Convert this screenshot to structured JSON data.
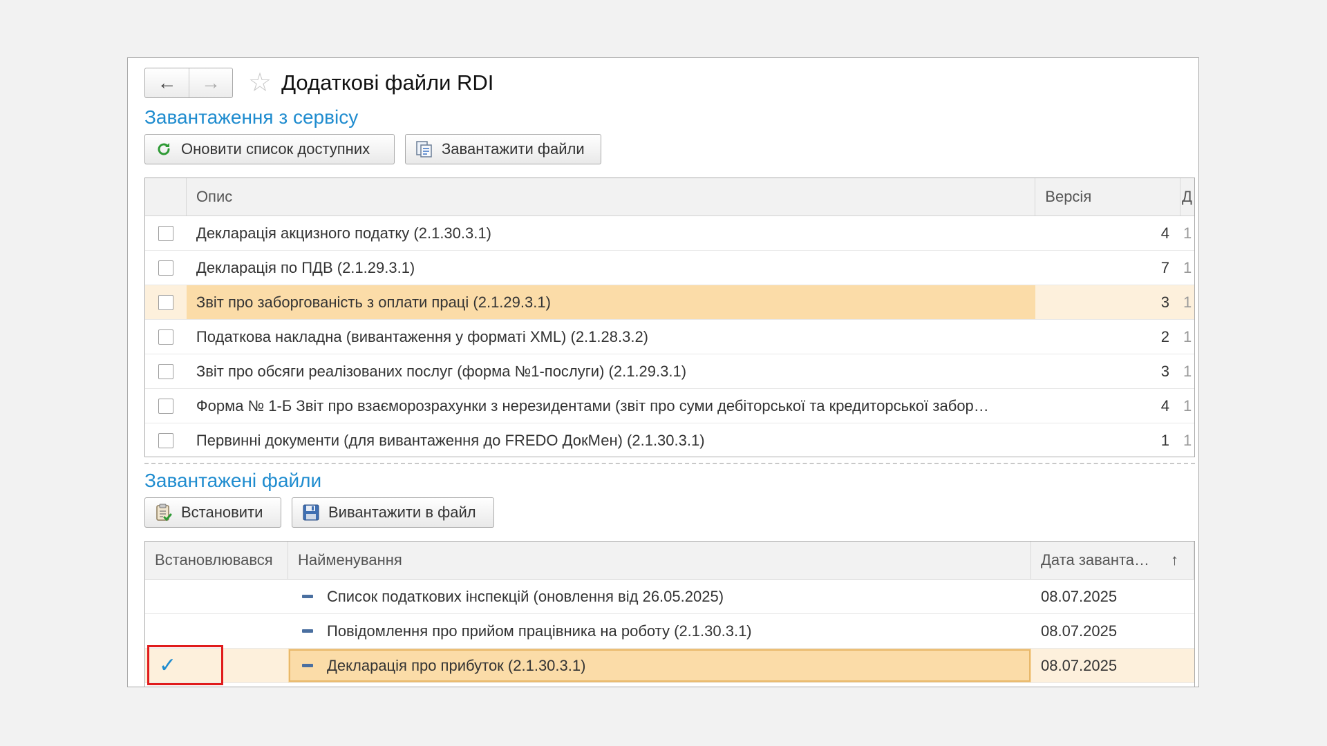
{
  "window": {
    "title": "Додаткові файли RDI",
    "nav_back": "←",
    "nav_forward": "→",
    "favorite": "☆"
  },
  "section_service": {
    "title": "Завантаження з сервісу",
    "refresh_label": "Оновити список доступних",
    "download_label": "Завантажити файли",
    "columns": [
      "",
      "Опис",
      "Версія",
      "Д"
    ],
    "rows": [
      {
        "checked": false,
        "description": "Декларація акцизного податку (2.1.30.3.1)",
        "version": "4",
        "extra": "1"
      },
      {
        "checked": false,
        "description": "Декларація по ПДВ (2.1.29.3.1)",
        "version": "7",
        "extra": "1"
      },
      {
        "checked": false,
        "description": "Звіт про заборгованість з оплати праці (2.1.29.3.1)",
        "version": "3",
        "extra": "1",
        "selected": true
      },
      {
        "checked": false,
        "description": "Податкова накладна (вивантаження у форматі XML) (2.1.28.3.2)",
        "version": "2",
        "extra": "1"
      },
      {
        "checked": false,
        "description": "Звіт про обсяги реалізованих послуг (форма №1-послуги) (2.1.29.3.1)",
        "version": "3",
        "extra": "1"
      },
      {
        "checked": false,
        "description": "Форма № 1-Б Звіт про взаєморозрахунки з нерезидентами (звіт про суми дебіторської та кредиторської забор…",
        "version": "4",
        "extra": "1"
      },
      {
        "checked": false,
        "description": "Первинні документи (для вивантаження до FREDO ДокМен) (2.1.30.3.1)",
        "version": "1",
        "extra": "1"
      }
    ]
  },
  "section_loaded": {
    "title": "Завантажені файли",
    "install_label": "Встановити",
    "export_label": "Вивантажити в файл",
    "columns": [
      "Встановлювався",
      "Найменування",
      "Дата заванта…"
    ],
    "sort_indicator": "↑",
    "rows": [
      {
        "installed": "",
        "name": "Список податкових інспекцій (оновлення від 26.05.2025)",
        "date": "08.07.2025"
      },
      {
        "installed": "",
        "name": "Повідомлення про прийом працівника на роботу (2.1.30.3.1)",
        "date": "08.07.2025"
      },
      {
        "installed": "✓",
        "name": "Декларація про прибуток (2.1.30.3.1)",
        "date": "08.07.2025",
        "selected": true
      }
    ]
  },
  "colors": {
    "section_title": "#1f8ccf",
    "selected_row": "#fdf0dc",
    "selected_cell": "#fbdca8",
    "highlight_box": "#e01b1b",
    "check": "#1f8ccf"
  }
}
